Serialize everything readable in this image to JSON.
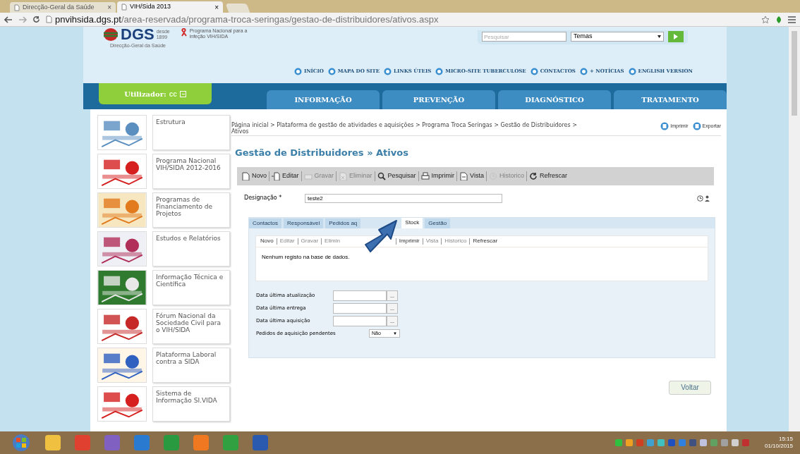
{
  "browser": {
    "tabs": [
      {
        "title": "Direcção-Geral da Saúde",
        "selected": false,
        "close": "×"
      },
      {
        "title": "VIH/Sida 2013",
        "selected": true,
        "close": "×"
      }
    ],
    "url_host": "pnvihsida.dgs.pt",
    "url_path": "/area-reservada/programa-troca-seringas/gestao-de-distribuidores/ativos.aspx"
  },
  "header": {
    "logo_text": "DGS",
    "logo_since": "desde 1899",
    "logo_caption": "Direcção-Geral da Saúde",
    "program_caption": "Programa Nacional para a infeção VIH/SIDA",
    "search": {
      "placeholder": "Pesquisar"
    },
    "topics": {
      "value": "Temas"
    },
    "links": [
      "INÍCIO",
      "MAPA DO SITE",
      "LINKS ÚTEIS",
      "MICRO-SITE TUBERCULOSE",
      "CONTACTOS",
      "+ NOTÍCIAS",
      "ENGLISH VERSION"
    ]
  },
  "user": {
    "label": "Utilizador:",
    "name": "cc"
  },
  "nav": [
    {
      "label": "INFORMAÇÃO"
    },
    {
      "label": "PREVENÇÃO"
    },
    {
      "label": "DIAGNÓSTICO"
    },
    {
      "label": "TRATAMENTO"
    }
  ],
  "sidebar": {
    "items": [
      {
        "label": "Estrutura"
      },
      {
        "label": "Programa Nacional VIH/SIDA 2012-2016"
      },
      {
        "label": "Programas de Financiamento de Projetos"
      },
      {
        "label": "Estudos e Relatórios"
      },
      {
        "label": "Informação Técnica e Científica"
      },
      {
        "label": "Fórum Nacional da Sociedade Civil para o VIH/SIDA"
      },
      {
        "label": "Plataforma Laboral contra a SIDA"
      },
      {
        "label": "Sistema de Informação SI.VIDA"
      }
    ]
  },
  "breadcrumb": "Página inicial > Plataforma de gestão de atividades e aquisições > Programa Troca Seringas > Gestão de Distribuidores > Ativos",
  "page_actions": [
    "Imprimir",
    "Exportar"
  ],
  "title": "Gestão de Distribuidores » Ativos",
  "toolbar": [
    {
      "label": "Novo",
      "disabled": false
    },
    {
      "label": "Editar",
      "disabled": false
    },
    {
      "label": "Gravar",
      "disabled": true
    },
    {
      "label": "Eliminar",
      "disabled": true
    },
    {
      "label": "Pesquisar",
      "disabled": false
    },
    {
      "label": "Imprimir",
      "disabled": false
    },
    {
      "label": "Vista",
      "disabled": false
    },
    {
      "label": "Historico",
      "disabled": true
    },
    {
      "label": "Refrescar",
      "disabled": false
    }
  ],
  "designation": {
    "label": "Designação *",
    "value": "teste2"
  },
  "tabs": [
    {
      "label": "Contactos",
      "selected": false
    },
    {
      "label": "Responsável",
      "selected": false
    },
    {
      "label": "Pedidos aq",
      "selected": false,
      "covered": true
    },
    {
      "label": "Stock",
      "selected": true
    },
    {
      "label": "Gestão",
      "selected": false
    }
  ],
  "subtoolbar": [
    {
      "label": "Novo",
      "disabled": false
    },
    {
      "label": "Editar",
      "disabled": true
    },
    {
      "label": "Gravar",
      "disabled": true
    },
    {
      "label": "Elimin",
      "disabled": true,
      "covered": true
    },
    {
      "label": "Imprimir",
      "disabled": false
    },
    {
      "label": "Vista",
      "disabled": true
    },
    {
      "label": "Historico",
      "disabled": true
    },
    {
      "label": "Refrescar",
      "disabled": false
    }
  ],
  "empty_message": "Nenhum registo na base de dados.",
  "fields": [
    {
      "kind": "date",
      "label": "Data última atualização",
      "button": "..."
    },
    {
      "kind": "date",
      "label": "Data última entrega",
      "button": "..."
    },
    {
      "kind": "date",
      "label": "Data última aquisição",
      "button": "..."
    },
    {
      "kind": "select",
      "label": "Pedidos de aquisição pendentes",
      "value": "Não",
      "caret": "▼"
    }
  ],
  "back_button": "Voltar",
  "taskbar": {
    "time": "15:15",
    "date": "01/10/2015"
  }
}
